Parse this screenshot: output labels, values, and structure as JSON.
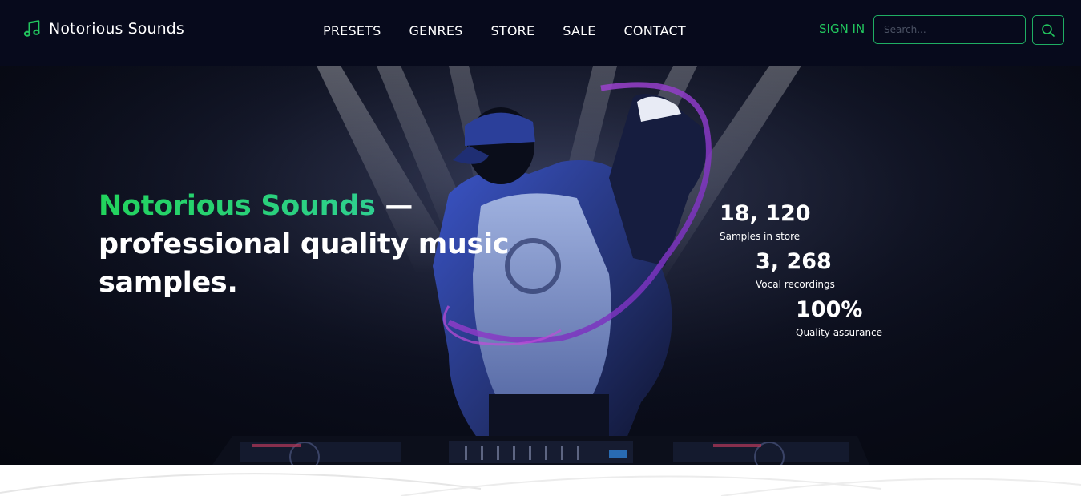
{
  "brand": {
    "name": "Notorious Sounds",
    "icon": "music-note-icon",
    "accent_color": "#22c55e"
  },
  "nav": {
    "items": [
      {
        "label": "PRESETS"
      },
      {
        "label": "GENRES"
      },
      {
        "label": "STORE"
      },
      {
        "label": "SALE"
      },
      {
        "label": "CONTACT"
      }
    ]
  },
  "auth": {
    "sign_in_label": "SIGN IN"
  },
  "search": {
    "placeholder": "Search...",
    "value": "",
    "button_icon": "search-icon"
  },
  "hero": {
    "headline_accent": "Notorious Sounds",
    "headline_dash": " —",
    "headline_rest": "professional quality music samples."
  },
  "stats": [
    {
      "value": "18, 120",
      "label": "Samples in store",
      "bar_color": "#5b1f7a"
    },
    {
      "value": "3, 268",
      "label": "Vocal recordings",
      "bar_color": "#155c30"
    },
    {
      "value": "100%",
      "label": "Quality assurance",
      "bar_color": "#1c4450"
    }
  ]
}
